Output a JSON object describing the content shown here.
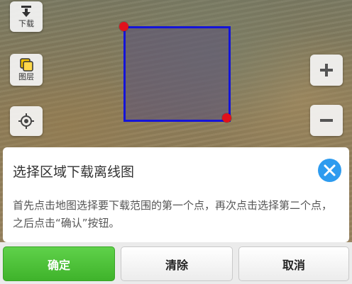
{
  "map": {
    "controls": {
      "download_label": "下载",
      "layers_label": "图层",
      "icons": {
        "download": "download-icon",
        "layers": "layers-icon",
        "locate": "locate-icon",
        "zoom_in": "plus-icon",
        "zoom_out": "minus-icon"
      }
    },
    "selection_color": "#1414d8",
    "marker_color": "#e0111b"
  },
  "panel": {
    "title": "选择区域下载离线图",
    "description": "首先点击地图选择要下载范围的第一个点，再次点击选择第二个点，之后点击“确认”按钮。",
    "close_icon": "close-icon",
    "accent": "#2d9bef"
  },
  "actions": {
    "confirm_label": "确定",
    "clear_label": "清除",
    "cancel_label": "取消",
    "confirm_color": "#46b932"
  }
}
